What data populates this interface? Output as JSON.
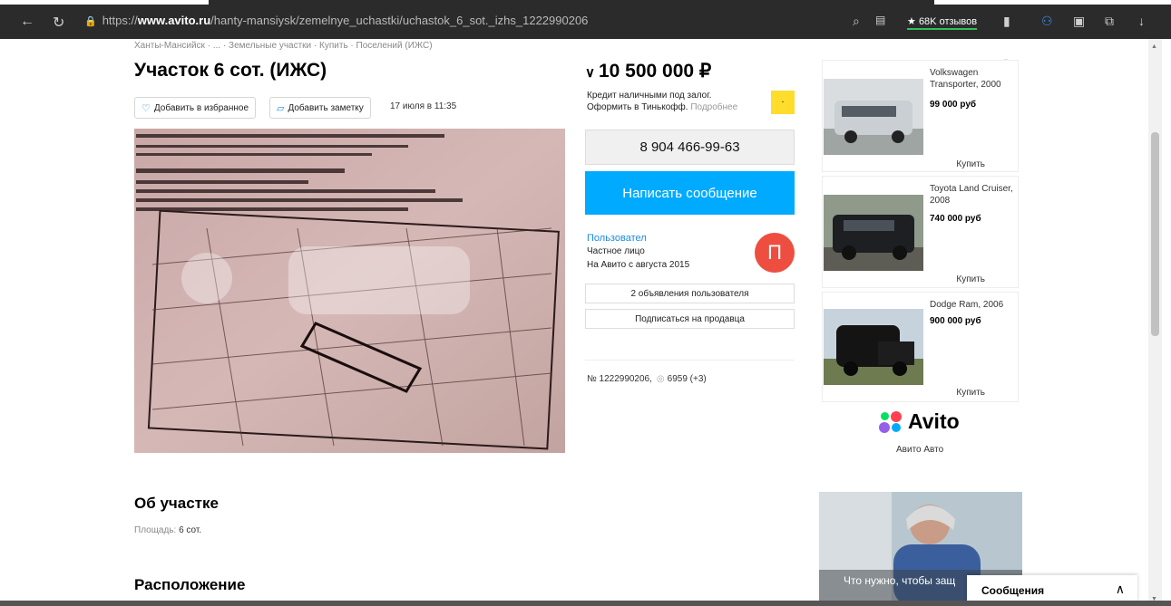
{
  "browser": {
    "url_prefix": "https://",
    "url_host": "www.avito.ru",
    "url_path": "/hanty-mansiysk/zemelnye_uchastki/uchastok_6_sot._izhs_1222990206",
    "reviews_label": "68K отзывов"
  },
  "breadcrumb": "Ханты-Мансийск · ... · Земельные участки · Купить · Поселений (ИЖС)",
  "listing": {
    "title": "Участок 6 сот. (ИЖС)",
    "favorite_label": "Добавить в избранное",
    "note_label": "Добавить заметку",
    "date": "17 июля в 11:35"
  },
  "price": {
    "value": "10 500 000 ₽",
    "credit_line1": "Кредит наличными под залог.",
    "credit_line2": "Оформить в Тинькофф.",
    "credit_more": "Подробнее"
  },
  "contact": {
    "phone": "8 904 466-99-63",
    "message_button": "Написать сообщение"
  },
  "seller": {
    "name": "Пользовател",
    "type": "Частное лицо",
    "since": "На Авито с августа 2015",
    "avatar_letter": "П",
    "listings_button": "2 объявления пользователя",
    "subscribe_button": "Подписаться на продавца"
  },
  "meta": {
    "ad_number": "№ 1222990206,",
    "views": "6959 (+3)"
  },
  "ads": [
    {
      "name": "Volkswagen Transporter, 2000",
      "price": "99 000 руб",
      "buy": "Купить"
    },
    {
      "name": "Toyota Land Cruiser, 2008",
      "price": "740 000 руб",
      "buy": "Купить"
    },
    {
      "name": "Dodge Ram, 2006",
      "price": "900 000 руб",
      "buy": "Купить"
    }
  ],
  "avito": {
    "logo": "Avito",
    "subtitle": "Авито Авто"
  },
  "about": {
    "heading": "Об участке",
    "area_label": "Площадь:",
    "area_value": "6 сот."
  },
  "location_heading": "Расположение",
  "banner_text": "Что нужно, чтобы защ",
  "messages_label": "Сообщения",
  "colors": {
    "accent_blue": "#00aaff",
    "link_blue": "#1a8ce5",
    "avatar_red": "#ee4e40"
  }
}
